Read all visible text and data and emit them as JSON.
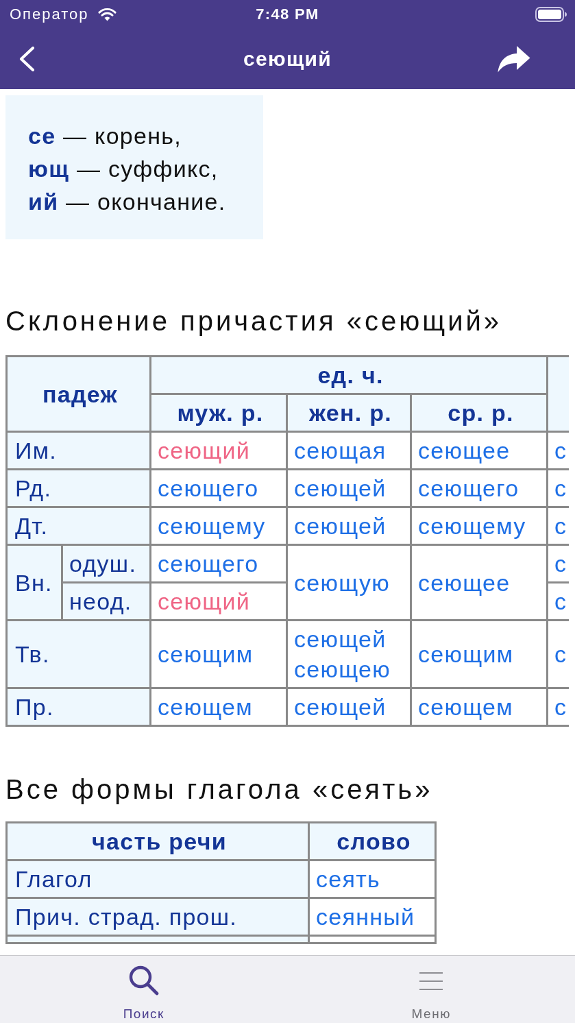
{
  "status_bar": {
    "carrier": "Оператор",
    "time": "7:48 PM"
  },
  "nav_bar": {
    "title": "сеющий"
  },
  "morphemes": [
    "**се** — корень,",
    "**ющ** — суффикс,",
    "**ий** — окончание."
  ],
  "declension": {
    "title": "Склонение причастия «сеющий»",
    "case_header": "падеж",
    "number_header": "ед. ч.",
    "gender_headers": [
      "муж. р.",
      "жен. р.",
      "ср. р."
    ],
    "rows": [
      {
        "kind": "simple",
        "case": "Им.",
        "masc": [
          {
            "text": "сеющий",
            "current": true
          }
        ],
        "fem": [
          {
            "text": "сеющая",
            "current": false
          }
        ],
        "neut": [
          {
            "text": "сеющее",
            "current": false
          }
        ],
        "plural": "с"
      },
      {
        "kind": "simple",
        "case": "Рд.",
        "masc": [
          {
            "text": "сеющего",
            "current": false
          }
        ],
        "fem": [
          {
            "text": "сеющей",
            "current": false
          }
        ],
        "neut": [
          {
            "text": "сеющего",
            "current": false
          }
        ],
        "plural": "с"
      },
      {
        "kind": "simple",
        "case": "Дт.",
        "masc": [
          {
            "text": "сеющему",
            "current": false
          }
        ],
        "fem": [
          {
            "text": "сеющей",
            "current": false
          }
        ],
        "neut": [
          {
            "text": "сеющему",
            "current": false
          }
        ],
        "plural": "с"
      },
      {
        "kind": "split",
        "case": "Вн.",
        "subrows": [
          {
            "label": "одуш.",
            "masc": [
              {
                "text": "сеющего",
                "current": false
              }
            ],
            "plural": "с"
          },
          {
            "label": "неод.",
            "masc": [
              {
                "text": "сеющий",
                "current": true
              }
            ],
            "plural": "с"
          }
        ],
        "fem": [
          {
            "text": "сеющую",
            "current": false
          }
        ],
        "neut": [
          {
            "text": "сеющее",
            "current": false
          }
        ]
      },
      {
        "kind": "simple",
        "case": "Тв.",
        "masc": [
          {
            "text": "сеющим",
            "current": false
          }
        ],
        "fem": [
          {
            "text": "сеющей",
            "current": false
          },
          {
            "text": "сеющею",
            "current": false
          }
        ],
        "neut": [
          {
            "text": "сеющим",
            "current": false
          }
        ],
        "plural": "с"
      },
      {
        "kind": "simple",
        "case": "Пр.",
        "masc": [
          {
            "text": "сеющем",
            "current": false
          }
        ],
        "fem": [
          {
            "text": "сеющей",
            "current": false
          }
        ],
        "neut": [
          {
            "text": "сеющем",
            "current": false
          }
        ],
        "plural": "с"
      }
    ]
  },
  "forms": {
    "title": "Все формы глагола «сеять»",
    "columns": [
      "часть речи",
      "слово"
    ],
    "rows": [
      {
        "part": "Глагол",
        "word": "сеять"
      },
      {
        "part": "Прич. страд. прош.",
        "word": "сеянный"
      }
    ],
    "continues_below": true
  },
  "tab_bar": [
    {
      "label": "Поиск",
      "selected": true
    },
    {
      "label": "Меню",
      "selected": false
    }
  ]
}
